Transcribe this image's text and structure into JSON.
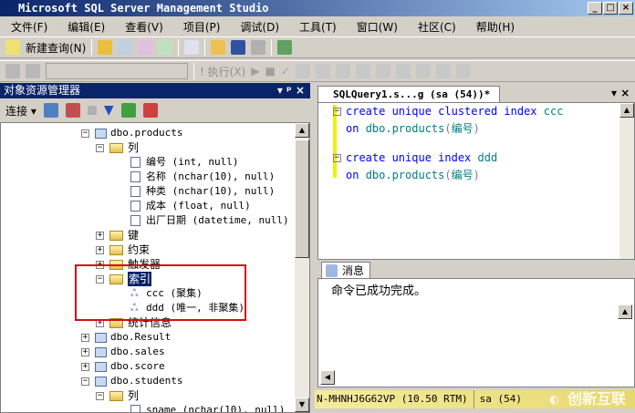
{
  "window": {
    "title": "Microsoft SQL Server Management Studio",
    "minimize": "_",
    "maximize": "□",
    "close": "×"
  },
  "menu": [
    "文件(F)",
    "编辑(E)",
    "查看(V)",
    "项目(P)",
    "调试(D)",
    "工具(T)",
    "窗口(W)",
    "社区(C)",
    "帮助(H)"
  ],
  "toolbar": {
    "new_query": "新建查询(N)",
    "execute": "! 执行(X)"
  },
  "object_explorer": {
    "title": "对象资源管理器",
    "pin": "▾ ᵖ ×",
    "connect": "连接 ▾"
  },
  "tree": [
    {
      "exp": "−",
      "icon": "table",
      "label": "dbo.products",
      "level": 0
    },
    {
      "exp": "−",
      "icon": "folder",
      "label": "列",
      "level": 1
    },
    {
      "icon": "column",
      "label": "编号 (int, null)",
      "level": 2
    },
    {
      "icon": "column",
      "label": "名称 (nchar(10), null)",
      "level": 2
    },
    {
      "icon": "column",
      "label": "种类 (nchar(10), null)",
      "level": 2
    },
    {
      "icon": "column",
      "label": "成本 (float, null)",
      "level": 2
    },
    {
      "icon": "column",
      "label": "出厂日期 (datetime, null)",
      "level": 2
    },
    {
      "exp": "+",
      "icon": "folder",
      "label": "键",
      "level": 1
    },
    {
      "exp": "+",
      "icon": "folder",
      "label": "约束",
      "level": 1
    },
    {
      "exp": "+",
      "icon": "folder",
      "label": "触发器",
      "level": 1
    },
    {
      "exp": "−",
      "icon": "folder",
      "label": "索引",
      "level": 1,
      "selected": true
    },
    {
      "icon": "index",
      "label": "ccc (聚集)",
      "level": 2
    },
    {
      "icon": "index",
      "label": "ddd (唯一, 非聚集)",
      "level": 2
    },
    {
      "exp": "+",
      "icon": "folder",
      "label": "统计信息",
      "level": 1
    },
    {
      "exp": "+",
      "icon": "table",
      "label": "dbo.Result",
      "level": 0
    },
    {
      "exp": "+",
      "icon": "table",
      "label": "dbo.sales",
      "level": 0
    },
    {
      "exp": "+",
      "icon": "table",
      "label": "dbo.score",
      "level": 0
    },
    {
      "exp": "−",
      "icon": "table",
      "label": "dbo.students",
      "level": 0
    },
    {
      "exp": "−",
      "icon": "folder",
      "label": "列",
      "level": 1
    },
    {
      "icon": "column",
      "label": "sname (nchar(10), null)",
      "level": 2
    }
  ],
  "editor": {
    "tab": "SQLQuery1.s...g (sa (54))*",
    "lines": [
      [
        [
          "kw",
          "create unique clustered index "
        ],
        [
          "id",
          "ccc"
        ]
      ],
      [
        [
          "kw",
          "on "
        ],
        [
          "id",
          "dbo.products"
        ],
        [
          "pn",
          "("
        ],
        [
          "id",
          "编号"
        ],
        [
          "pn",
          ")"
        ]
      ],
      [],
      [
        [
          "kw",
          "create unique index "
        ],
        [
          "id",
          "ddd"
        ]
      ],
      [
        [
          "kw",
          "on "
        ],
        [
          "id",
          "dbo.products"
        ],
        [
          "pn",
          "("
        ],
        [
          "id",
          "编号"
        ],
        [
          "pn",
          ")"
        ]
      ]
    ]
  },
  "messages": {
    "tab": "消息",
    "text": "命令已成功完成。"
  },
  "status": {
    "server": "N-MHNHJ6G62VP (10.50 RTM)",
    "user": "sa (54)"
  },
  "watermark": "创新互联"
}
